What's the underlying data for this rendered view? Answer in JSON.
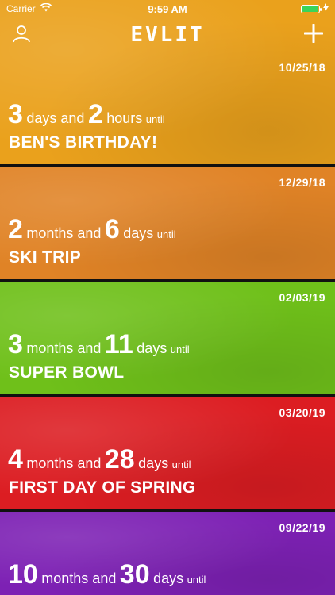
{
  "status_bar": {
    "carrier": "Carrier",
    "time": "9:59 AM",
    "battery_level": 1.0
  },
  "app": {
    "title": "EVLIT"
  },
  "icons": {
    "profile": "person-icon",
    "add": "plus-icon",
    "wifi": "wifi-icon",
    "battery": "battery-icon",
    "charging": "bolt-icon"
  },
  "events": [
    {
      "date": "10/25/18",
      "n1": "3",
      "u1": "days and",
      "n2": "2",
      "u2": "hours",
      "until": "until",
      "name": "BEN'S BIRTHDAY!",
      "color": "#eaa11c"
    },
    {
      "date": "12/29/18",
      "n1": "2",
      "u1": "months and",
      "n2": "6",
      "u2": "days",
      "until": "until",
      "name": "SKI TRIP",
      "color": "#e08326"
    },
    {
      "date": "02/03/19",
      "n1": "3",
      "u1": "months and",
      "n2": "11",
      "u2": "days",
      "until": "until",
      "name": "SUPER BOWL",
      "color": "#6fc01a"
    },
    {
      "date": "03/20/19",
      "n1": "4",
      "u1": "months and",
      "n2": "28",
      "u2": "days",
      "until": "until",
      "name": "FIRST DAY OF SPRING",
      "color": "#dc1d22"
    },
    {
      "date": "09/22/19",
      "n1": "10",
      "u1": "months and",
      "n2": "30",
      "u2": "days",
      "until": "until",
      "name": "",
      "color": "#7d21b4"
    }
  ]
}
